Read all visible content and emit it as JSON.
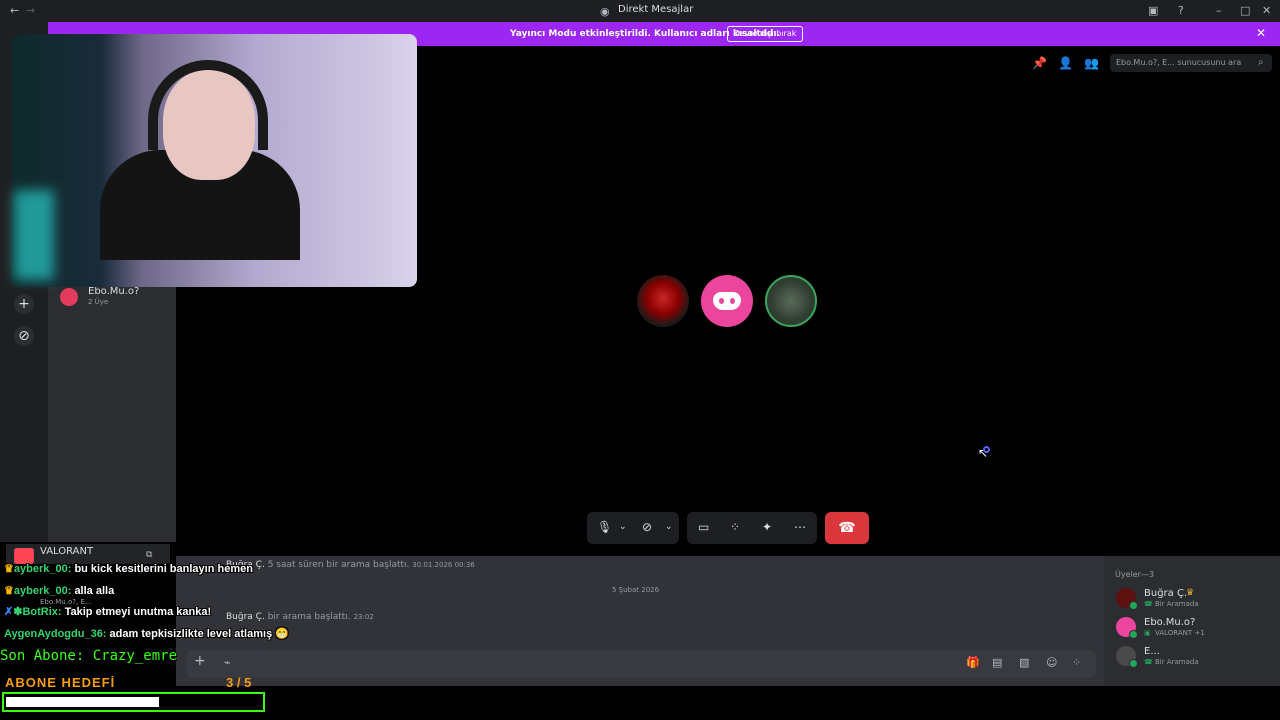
{
  "window": {
    "title": "Direkt Mesajlar"
  },
  "banner": {
    "text": "Yayıncı Modu etkinleştirildi. Kullanıcı adları kısaltıldı.",
    "button": "Devre dışı bırak"
  },
  "call": {
    "search_placeholder": "Ebo.Mu.o?, E... sunucusunu ara",
    "participants": [
      "Buğra Ç.",
      "Ebo.Mu.o?",
      "E..."
    ]
  },
  "sidebar": {
    "dm_name": "Ebo.Mu.o?",
    "dm_sub": "2 Üye",
    "activity_title": "VALORANT",
    "voice_label": "Ebo.Mu.o?, E..."
  },
  "chat": {
    "system1_user": "Buğra Ç.",
    "system1_text": "5 saat süren bir arama başlattı.",
    "system1_time": "30.01.2026 00:36",
    "date_divider": "5 Şubat 2026",
    "system2_user": "Buğra Ç.",
    "system2_text": "bir arama başlattı.",
    "system2_time": "23:02"
  },
  "members": {
    "header": "Üyeler—3",
    "list": [
      {
        "name": "Buğra Ç.",
        "status": "Bir Aramada",
        "color": "#5c1010"
      },
      {
        "name": "Ebo.Mu.o?",
        "status": "VALORANT +1",
        "color": "#eb459e"
      },
      {
        "name": "E...",
        "status": "Bir Aramada",
        "color": "#4a4a4a"
      }
    ]
  },
  "overlay": {
    "messages": [
      {
        "user": "ayberk_00:",
        "text": "bu kick kesitlerini banlayın hemen"
      },
      {
        "user": "ayberk_00:",
        "text": "alla alla"
      },
      {
        "user": "BotRix:",
        "text": "Takip etmeyi unutma kanka!"
      },
      {
        "user": "AygenAydogdu_36:",
        "text": "adam tepkisizlikte level atlamış 😁"
      }
    ],
    "last_sub": "Son Abone: Crazy_emre",
    "goal_label": "ABONE HEDEFİ",
    "goal_count": "3 / 5",
    "goal_progress": 0.6
  },
  "colors": {
    "accent": "#9c27f2",
    "danger": "#da373c",
    "online": "#23a55a",
    "overlay_green": "#39ff14",
    "goal_orange": "#f39c12"
  }
}
